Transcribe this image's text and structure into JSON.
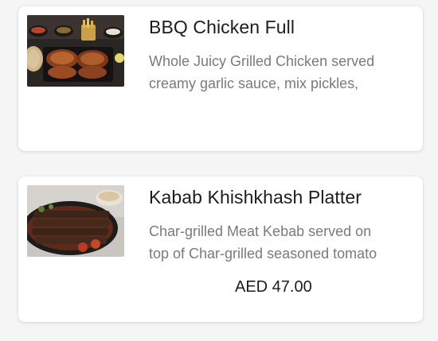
{
  "items": [
    {
      "title": "BBQ Chicken Full",
      "description_lines": [
        "Whole Juicy Grilled Chicken served",
        "creamy garlic sauce, mix pickles,"
      ],
      "price": "",
      "image": "bbq-chicken-photo"
    },
    {
      "title": "Kabab Khishkhash Platter",
      "description_lines": [
        "Char-grilled Meat Kebab served on",
        "top of Char-grilled seasoned tomato"
      ],
      "price": "AED 47.00",
      "image": "kabab-platter-photo"
    }
  ]
}
